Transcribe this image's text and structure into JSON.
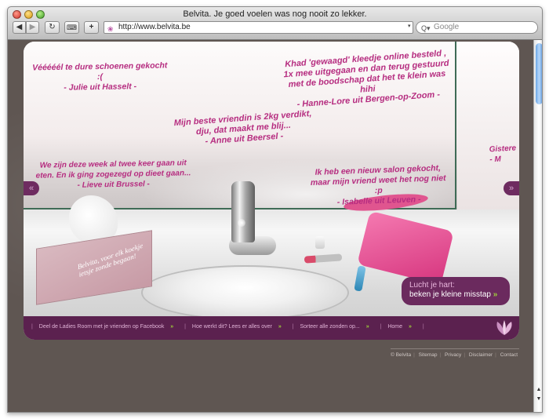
{
  "browser": {
    "window_title": "Belvita. Je goed voelen was nog nooit zo lekker.",
    "url": "http://www.belvita.be",
    "search_placeholder": "Google",
    "nav": {
      "back": "◀",
      "forward": "▶",
      "reload": "↻",
      "keyboard": "⌨",
      "add": "+"
    }
  },
  "site": {
    "quotes": [
      {
        "text": "Vééééél te dure schoenen gekocht :(",
        "author": "- Julie uit Hasselt -"
      },
      {
        "text": "Khad 'gewaagd' kleedje online besteld , 1x mee uitgegaan en dan terug gestuurd met de boodschap dat het te klein was hihi",
        "author": "- Hanne-Lore uit Bergen-op-Zoom -"
      },
      {
        "text": "Mijn beste vriendin is 2kg verdikt, dju, dat maakt me blij...",
        "author": "- Anne uit Beersel -"
      },
      {
        "text": "We zijn deze week al twee keer gaan uit eten. En ik ging zogezegd op dieet gaan...",
        "author": "- Lieve uit Brussel -"
      },
      {
        "text": "Ik heb een nieuw salon gekocht, maar mijn vriend weet het nog niet :p",
        "author": "- Isabelle uit Leuven -"
      },
      {
        "text": "Gistere",
        "author": "- M"
      }
    ],
    "tissue_box_text": "Belvita, voor elk koekje ietsje zonde begaan!",
    "arrow_left": "«",
    "arrow_right": "»",
    "cta": {
      "line1": "Lucht je hart:",
      "line2": "beken je kleine misstap",
      "chevron": "»"
    },
    "footer_links": [
      {
        "label": "Deel de Ladies Room met je vrienden op Facebook",
        "chevron": "»"
      },
      {
        "label": "Hoe werkt dit? Lees er alles over",
        "chevron": "»"
      },
      {
        "label": "Sorteer alle zonden op...",
        "chevron": "»"
      },
      {
        "label": "Home",
        "chevron": "»"
      }
    ],
    "bottom_links": [
      "© Belvita",
      "Sitemap",
      "Privacy",
      "Disclaimer",
      "Contact"
    ]
  },
  "colors": {
    "brand_purple": "#5b214f",
    "quote_pink": "#b62d80",
    "accent_green": "#9ecf3a"
  }
}
